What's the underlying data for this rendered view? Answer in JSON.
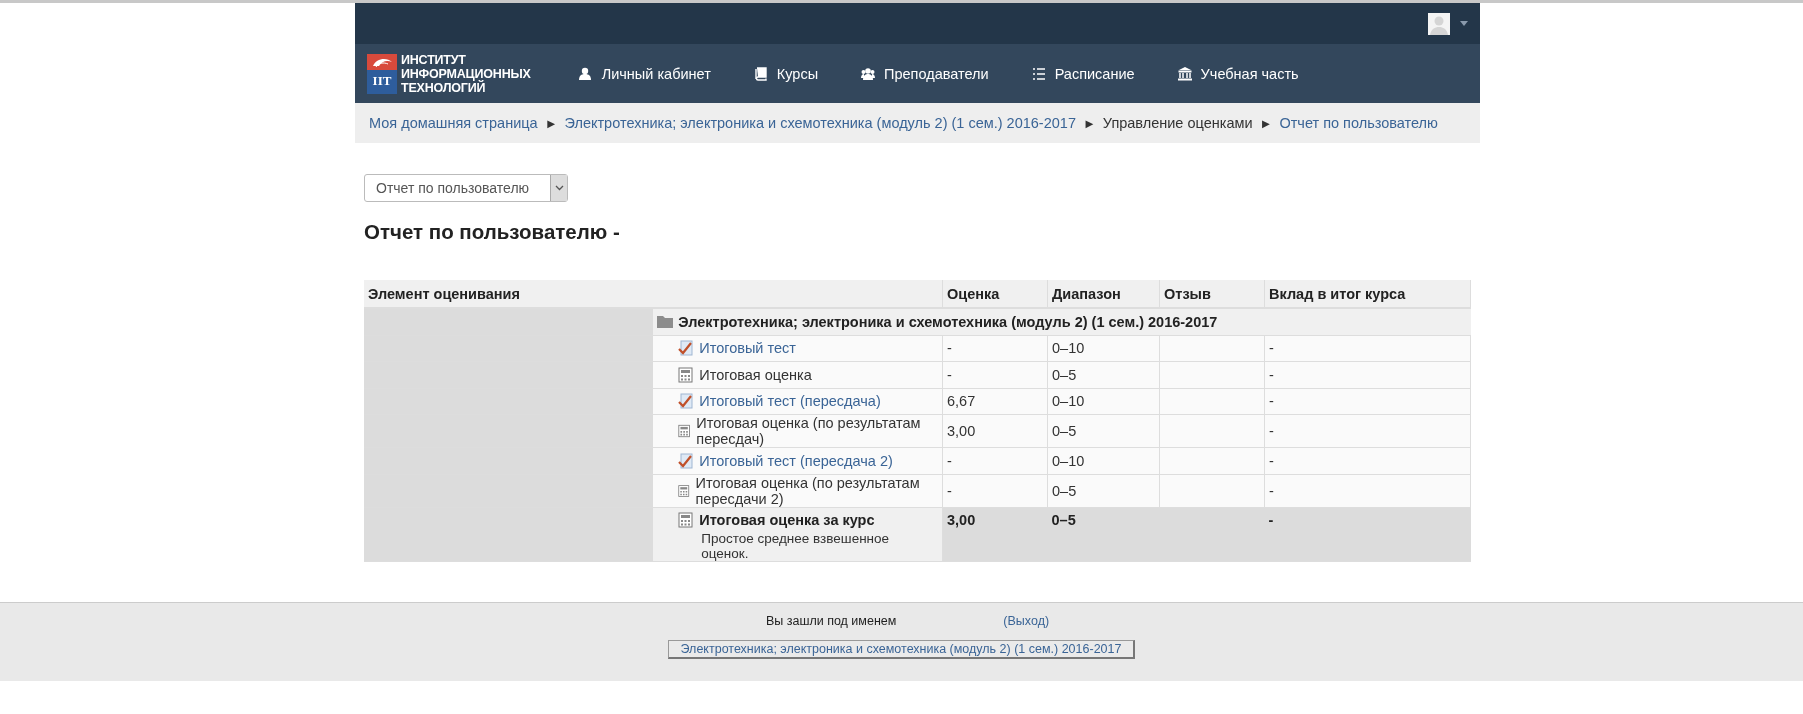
{
  "logo": {
    "badge": "IIT",
    "lines": [
      "ИНСТИТУТ",
      "ИНФОРМАЦИОННЫХ",
      "ТЕХНОЛОГИЙ"
    ]
  },
  "nav": [
    {
      "label": "Личный кабинет"
    },
    {
      "label": "Курсы"
    },
    {
      "label": "Преподаватели"
    },
    {
      "label": "Расписание"
    },
    {
      "label": "Учебная часть"
    }
  ],
  "breadcrumb": [
    {
      "kind": "link",
      "text": "Моя домашняя страница"
    },
    {
      "kind": "separator",
      "text": "►"
    },
    {
      "kind": "link",
      "text": "Электротехника; электроника и схемотехника (модуль 2) (1 сем.) 2016-2017"
    },
    {
      "kind": "separator",
      "text": "►"
    },
    {
      "kind": "current",
      "text": "Управление оценками"
    },
    {
      "kind": "separator",
      "text": "►"
    },
    {
      "kind": "link",
      "text": "Отчет по пользователю"
    }
  ],
  "report_select": {
    "value": "Отчет по пользователю"
  },
  "heading": "Отчет по пользователю -",
  "table": {
    "columns": [
      "Элемент оценивания",
      "Оценка",
      "Диапазон",
      "Отзыв",
      "Вклад в итог курса"
    ],
    "rows": [
      {
        "kind": "category",
        "name": "Электротехника; электроника и схемотехника (модуль 2) (1 сем.) 2016-2017"
      },
      {
        "kind": "quiz",
        "name": "Итоговый тест",
        "grade": "-",
        "range": "0–10",
        "contribution": "-"
      },
      {
        "kind": "calculation",
        "name": "Итоговая оценка",
        "grade": "-",
        "range": "0–5",
        "contribution": "-"
      },
      {
        "kind": "quiz",
        "name": "Итоговый тест (пересдача)",
        "grade": "6,67",
        "range": "0–10",
        "contribution": "-"
      },
      {
        "kind": "calculation",
        "name": "Итоговая оценка (по результатам пересдач)",
        "grade": "3,00",
        "range": "0–5",
        "contribution": "-"
      },
      {
        "kind": "quiz",
        "name": "Итоговый тест (пересдача 2)",
        "grade": "-",
        "range": "0–10",
        "contribution": "-"
      },
      {
        "kind": "calculation",
        "name": "Итоговая оценка (по результатам пересдачи 2)",
        "grade": "-",
        "range": "0–5",
        "contribution": "-"
      },
      {
        "kind": "total",
        "name": "Итоговая оценка за курс",
        "description": "Простое среднее взвешенное оценок.",
        "grade": "3,00",
        "range": "0–5",
        "contribution": "-"
      }
    ]
  },
  "footer": {
    "login_text": "Вы зашли под именем",
    "logout": "(Выход)",
    "course_button": "Электротехника; электроника и схемотехника (модуль 2) (1 сем.) 2016-2017"
  }
}
